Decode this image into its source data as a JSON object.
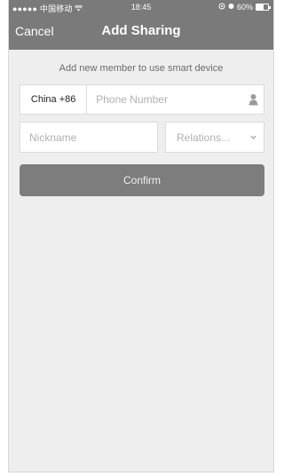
{
  "status_bar": {
    "carrier": "●●●●● 中国移动",
    "time": "18:45",
    "battery": "60%",
    "battery_level": 0.6
  },
  "nav": {
    "cancel_label": "Cancel",
    "title": "Add Sharing"
  },
  "form": {
    "hint": "Add new member to use smart device",
    "country_code": "China +86",
    "phone_placeholder": "Phone Number",
    "nickname_placeholder": "Nickname",
    "relation_label": "Relations...",
    "confirm_label": "Confirm"
  },
  "colors": {
    "header": "#7a7a7a",
    "background": "#eeeeee",
    "button": "#7d7d7d"
  }
}
